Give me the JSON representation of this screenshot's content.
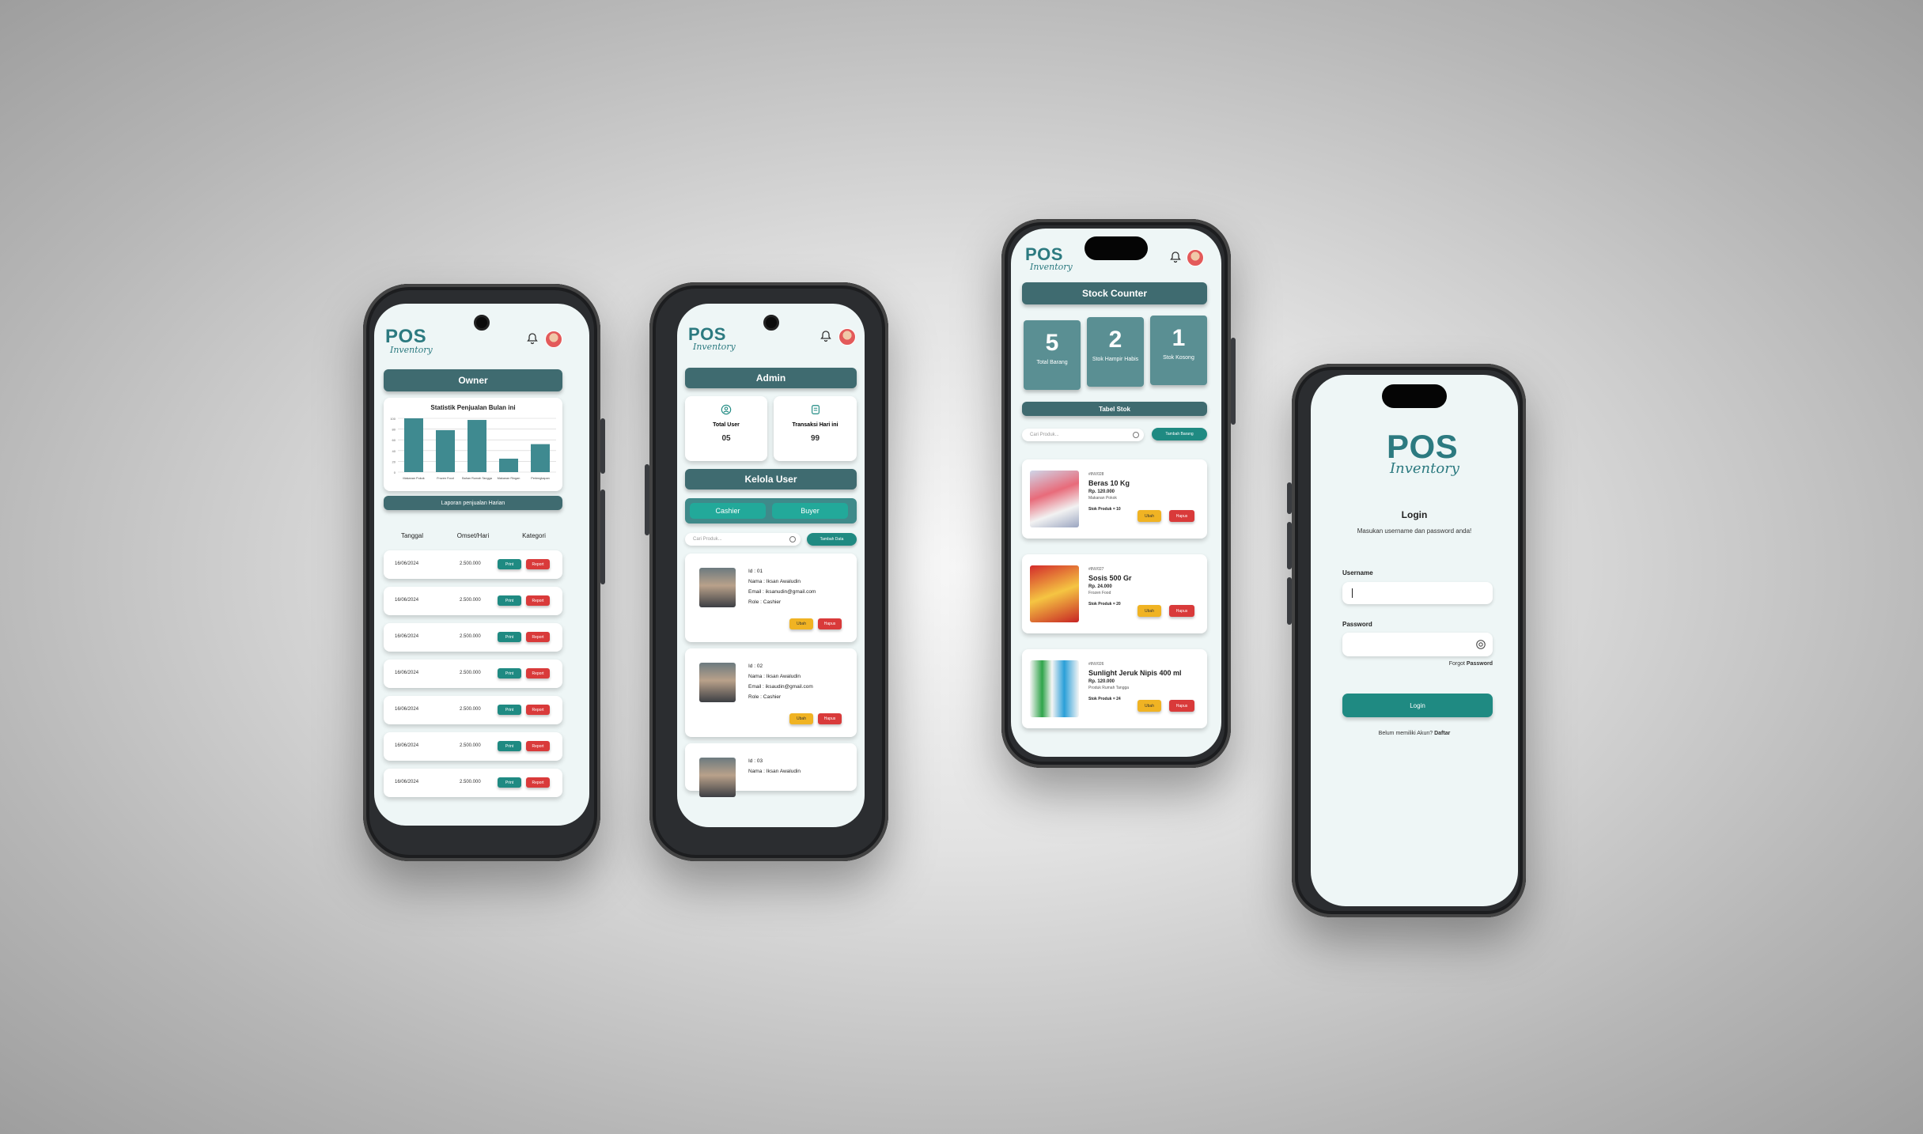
{
  "brand": {
    "pos": "POS",
    "inventory": "Inventory"
  },
  "owner": {
    "title": "Owner",
    "chart_title": "Statistik Penjualan Bulan ini",
    "report_title": "Laporan penjualan Harian",
    "table_headers": [
      "Tanggal",
      "Omset/Hari",
      "Kategori"
    ],
    "rows": [
      {
        "date": "16/06/2024",
        "amount": "2.500.000",
        "print": "Print",
        "report": "Report"
      },
      {
        "date": "16/06/2024",
        "amount": "2.500.000",
        "print": "Print",
        "report": "Report"
      },
      {
        "date": "16/06/2024",
        "amount": "2.500.000",
        "print": "Print",
        "report": "Report"
      },
      {
        "date": "16/06/2024",
        "amount": "2.500.000",
        "print": "Print",
        "report": "Report"
      },
      {
        "date": "16/06/2024",
        "amount": "2.500.000",
        "print": "Print",
        "report": "Report"
      },
      {
        "date": "16/06/2024",
        "amount": "2.500.000",
        "print": "Print",
        "report": "Report"
      },
      {
        "date": "16/06/2024",
        "amount": "2.500.000",
        "print": "Print",
        "report": "Report"
      }
    ]
  },
  "chart_data": {
    "type": "bar",
    "title": "Statistik Penjualan Bulan ini",
    "categories": [
      "Makanan Pokok",
      "Frozen Food",
      "Bahan Rumah Tangga",
      "Makanan Ringan",
      "Perlengkapan"
    ],
    "values": [
      100,
      78,
      97,
      25,
      52
    ],
    "ylim": [
      0,
      100
    ],
    "yticks": [
      "100",
      "80",
      "60",
      "40",
      "20",
      "0"
    ],
    "grid": true,
    "color": "#3f8a90"
  },
  "admin": {
    "title": "Admin",
    "total_user_label": "Total User",
    "total_user_value": "05",
    "transaksi_label": "Transaksi Hari ini",
    "transaksi_value": "99",
    "kelola_title": "Kelola User",
    "tabs": [
      "Cashier",
      "Buyer"
    ],
    "search_placeholder": "Cari Produk...",
    "add_button": "Tambah Data",
    "users": [
      {
        "id": "Id : 01",
        "name": "Nama : Iksan Awaludin",
        "email": "Email : iksanudin@gmail.com",
        "role": "Role : Cashier",
        "edit": "Ubah",
        "delete": "Hapus"
      },
      {
        "id": "Id : 02",
        "name": "Nama : Iksan Awaludin",
        "email": "Email : iksaudin@gmail.com",
        "role": "Role : Cashier",
        "edit": "Ubah",
        "delete": "Hapus"
      },
      {
        "id": "Id : 03",
        "name": "Nama : Iksan Awaludin"
      }
    ]
  },
  "stock": {
    "title": "Stock Counter",
    "stats": [
      {
        "value": "5",
        "label": "Total Barang"
      },
      {
        "value": "2",
        "label": "Stok Hampir Habis"
      },
      {
        "value": "1",
        "label": "Stok Kosong"
      }
    ],
    "table_title": "Tabel Stok",
    "search_placeholder": "Cari Produk...",
    "add_button": "Tambah Barang",
    "products": [
      {
        "code": "#INV028",
        "name": "Beras 10 Kg",
        "price": "Rp. 120.000",
        "category": "Makanan Pokok",
        "stock": "Stok Produk = 10",
        "edit": "Ubah",
        "delete": "Hapus"
      },
      {
        "code": "#INV027",
        "name": "Sosis 500 Gr",
        "price": "Rp. 24.000",
        "category": "Frozen Food",
        "stock": "Stok Produk = 20",
        "edit": "Ubah",
        "delete": "Hapus"
      },
      {
        "code": "#INV026",
        "name": "Sunlight Jeruk Nipis 400 ml",
        "price": "Rp. 120.000",
        "category": "Produk Rumah Tangga",
        "stock": "Stok Produk = 24",
        "edit": "Ubah",
        "delete": "Hapus"
      }
    ]
  },
  "login": {
    "title": "Login",
    "subtitle": "Masukan username dan password anda!",
    "username_label": "Username",
    "password_label": "Password",
    "forgot_prefix": "Forgot ",
    "forgot_link": "Password",
    "button": "Login",
    "signup_prefix": "Belum memiliki Akun? ",
    "signup_link": "Daftar"
  },
  "colors": {
    "teal_dark": "#3f6b70",
    "teal": "#1f8a82",
    "red": "#d93a3a",
    "yellow": "#f0b323",
    "screen_bg": "#eef6f6"
  }
}
